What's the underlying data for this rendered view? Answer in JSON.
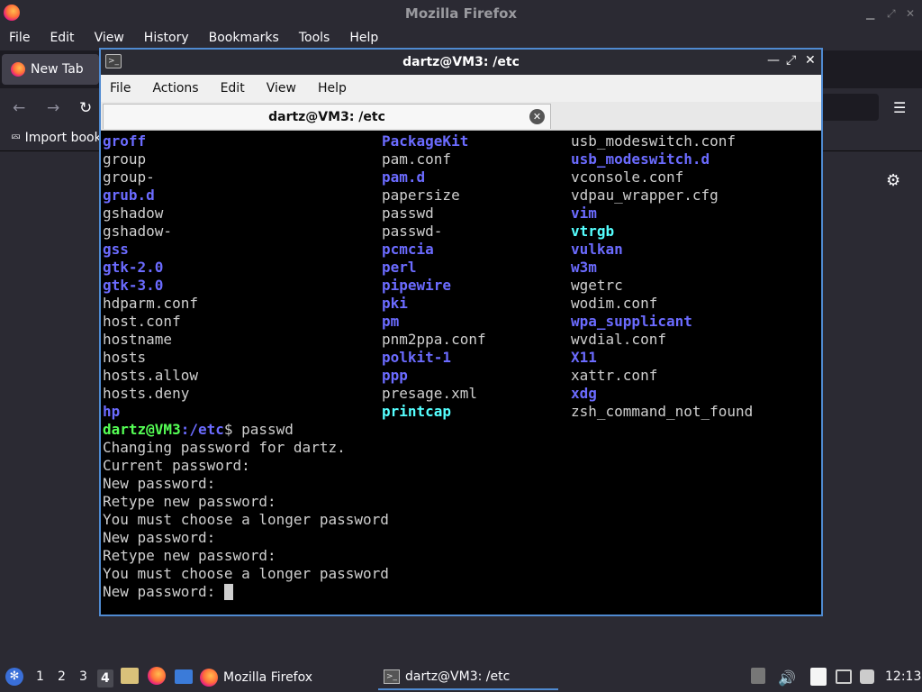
{
  "firefox": {
    "window_title": "Mozilla Firefox",
    "menu": [
      "File",
      "Edit",
      "View",
      "History",
      "Bookmarks",
      "Tools",
      "Help"
    ],
    "tab_label": "New Tab",
    "import_bookmarks": "Import book"
  },
  "terminal": {
    "window_title": "dartz@VM3: /etc",
    "menu": [
      "File",
      "Actions",
      "Edit",
      "View",
      "Help"
    ],
    "tab_label": "dartz@VM3: /etc",
    "ls_rows": [
      [
        {
          "t": "groff",
          "k": "dir"
        },
        {
          "t": "PackageKit",
          "k": "dir"
        },
        {
          "t": "usb_modeswitch.conf",
          "k": "plain"
        }
      ],
      [
        {
          "t": "group",
          "k": "plain"
        },
        {
          "t": "pam.conf",
          "k": "plain"
        },
        {
          "t": "usb_modeswitch.d",
          "k": "dir"
        }
      ],
      [
        {
          "t": "group-",
          "k": "plain"
        },
        {
          "t": "pam.d",
          "k": "dir"
        },
        {
          "t": "vconsole.conf",
          "k": "plain"
        }
      ],
      [
        {
          "t": "grub.d",
          "k": "dir"
        },
        {
          "t": "papersize",
          "k": "plain"
        },
        {
          "t": "vdpau_wrapper.cfg",
          "k": "plain"
        }
      ],
      [
        {
          "t": "gshadow",
          "k": "plain"
        },
        {
          "t": "passwd",
          "k": "plain"
        },
        {
          "t": "vim",
          "k": "dir"
        }
      ],
      [
        {
          "t": "gshadow-",
          "k": "plain"
        },
        {
          "t": "passwd-",
          "k": "plain"
        },
        {
          "t": "vtrgb",
          "k": "cyan"
        }
      ],
      [
        {
          "t": "gss",
          "k": "dir"
        },
        {
          "t": "pcmcia",
          "k": "dir"
        },
        {
          "t": "vulkan",
          "k": "dir"
        }
      ],
      [
        {
          "t": "gtk-2.0",
          "k": "dir"
        },
        {
          "t": "perl",
          "k": "dir"
        },
        {
          "t": "w3m",
          "k": "dir"
        }
      ],
      [
        {
          "t": "gtk-3.0",
          "k": "dir"
        },
        {
          "t": "pipewire",
          "k": "dir"
        },
        {
          "t": "wgetrc",
          "k": "plain"
        }
      ],
      [
        {
          "t": "hdparm.conf",
          "k": "plain"
        },
        {
          "t": "pki",
          "k": "dir"
        },
        {
          "t": "wodim.conf",
          "k": "plain"
        }
      ],
      [
        {
          "t": "host.conf",
          "k": "plain"
        },
        {
          "t": "pm",
          "k": "dir"
        },
        {
          "t": "wpa_supplicant",
          "k": "dir"
        }
      ],
      [
        {
          "t": "hostname",
          "k": "plain"
        },
        {
          "t": "pnm2ppa.conf",
          "k": "plain"
        },
        {
          "t": "wvdial.conf",
          "k": "plain"
        }
      ],
      [
        {
          "t": "hosts",
          "k": "plain"
        },
        {
          "t": "polkit-1",
          "k": "dir"
        },
        {
          "t": "X11",
          "k": "dir"
        }
      ],
      [
        {
          "t": "hosts.allow",
          "k": "plain"
        },
        {
          "t": "ppp",
          "k": "dir"
        },
        {
          "t": "xattr.conf",
          "k": "plain"
        }
      ],
      [
        {
          "t": "hosts.deny",
          "k": "plain"
        },
        {
          "t": "presage.xml",
          "k": "plain"
        },
        {
          "t": "xdg",
          "k": "dir"
        }
      ],
      [
        {
          "t": "hp",
          "k": "dir"
        },
        {
          "t": "printcap",
          "k": "cyan"
        },
        {
          "t": "zsh_command_not_found",
          "k": "plain"
        }
      ]
    ],
    "prompt_user": "dartz@VM3",
    "prompt_path": ":/etc",
    "prompt_symbol": "$ ",
    "command": "passwd",
    "output": [
      "Changing password for dartz.",
      "Current password:",
      "New password:",
      "Retype new password:",
      "You must choose a longer password",
      "New password:",
      "Retype new password:",
      "You must choose a longer password"
    ],
    "last_prompt": "New password: "
  },
  "taskbar": {
    "workspaces": [
      "1",
      "2",
      "3",
      "4"
    ],
    "active_workspace": "4",
    "firefox_task": "Mozilla Firefox",
    "terminal_task": "dartz@VM3: /etc",
    "clock": "12:13"
  }
}
